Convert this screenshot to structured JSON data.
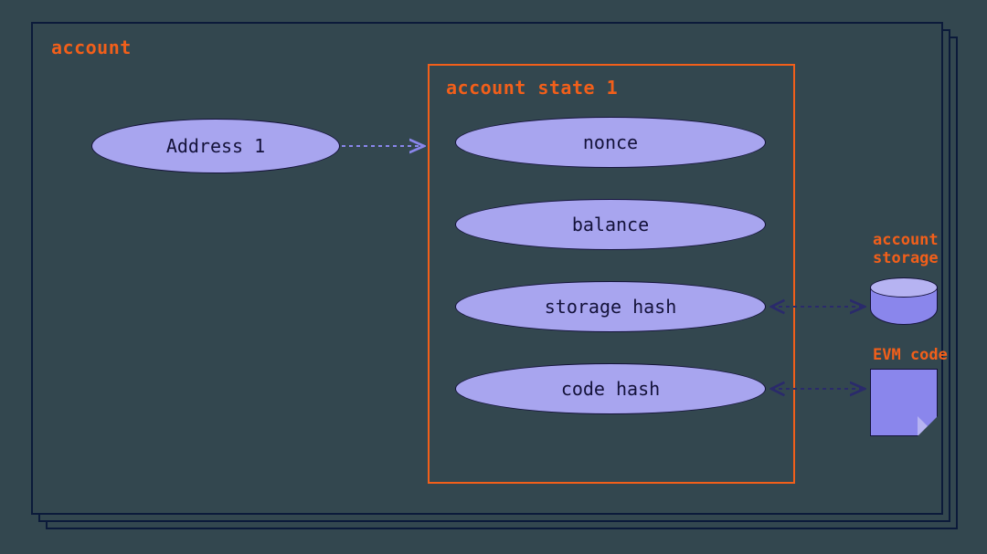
{
  "panel": {
    "title": "account"
  },
  "address": {
    "label": "Address 1"
  },
  "state": {
    "title": "account state 1",
    "fields": {
      "nonce": "nonce",
      "balance": "balance",
      "storage_hash": "storage hash",
      "code_hash": "code hash"
    }
  },
  "external": {
    "storage_label": "account storage",
    "evm_label": "EVM code"
  },
  "chart_data": {
    "type": "table",
    "title": "Ethereum account structure",
    "rows": [
      {
        "entity": "Account",
        "maps_to": "Account State",
        "via": "Address 1"
      },
      {
        "field": "nonce",
        "points_to": null
      },
      {
        "field": "balance",
        "points_to": null
      },
      {
        "field": "storage hash",
        "points_to": "account storage"
      },
      {
        "field": "code hash",
        "points_to": "EVM code"
      }
    ]
  }
}
